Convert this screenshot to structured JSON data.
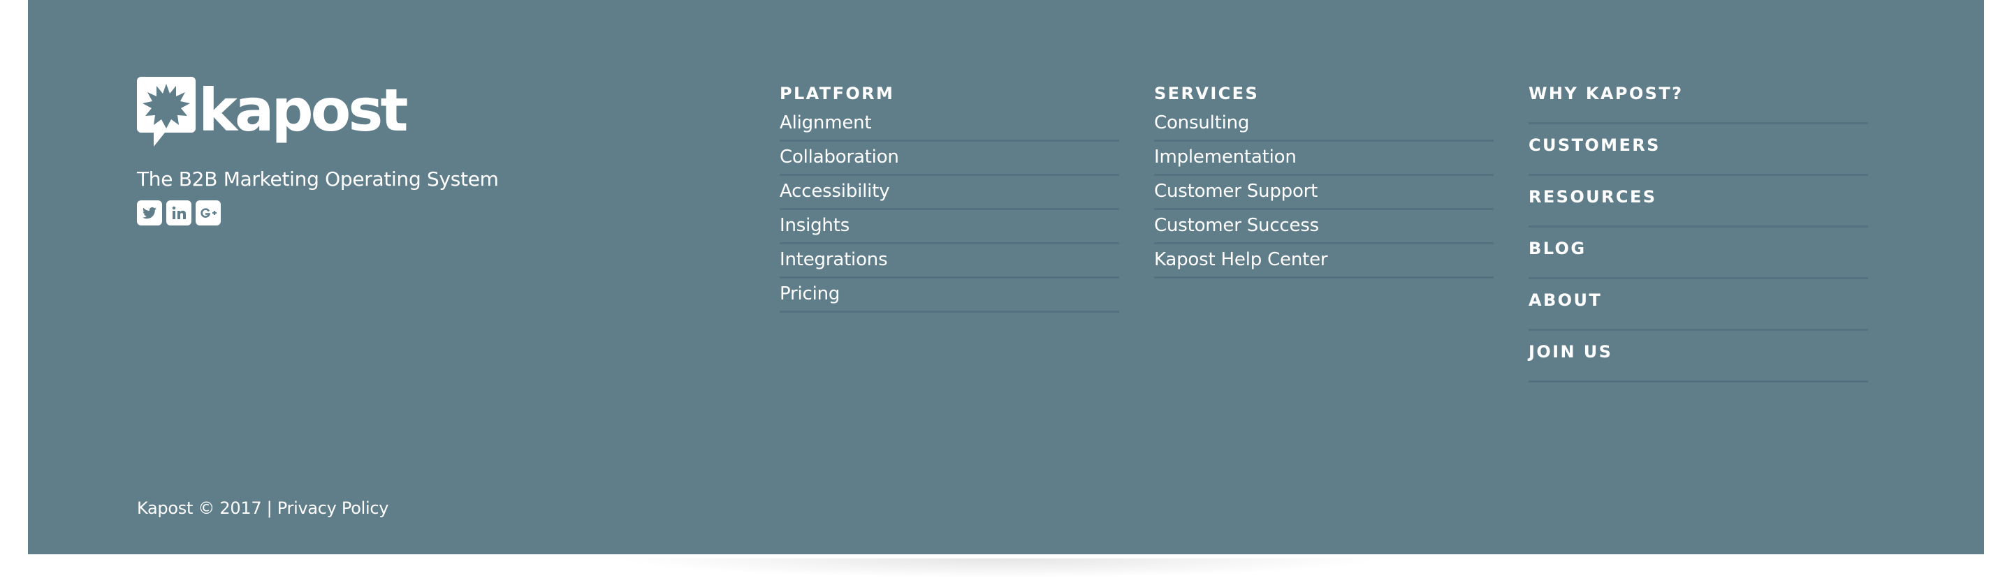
{
  "brand": {
    "logo_text": "kapost",
    "tagline": "The B2B Marketing Operating System",
    "social_icons": [
      "twitter-icon",
      "linkedin-icon",
      "google-plus-icon"
    ]
  },
  "platform": {
    "heading": "PLATFORM",
    "links": [
      "Alignment",
      "Collaboration",
      "Accessibility",
      "Insights",
      "Integrations",
      "Pricing"
    ]
  },
  "services": {
    "heading": "SERVICES",
    "links": [
      "Consulting",
      "Implementation",
      "Customer Support",
      "Customer Success",
      "Kapost Help Center"
    ]
  },
  "main_links": [
    "WHY KAPOST?",
    "CUSTOMERS",
    "RESOURCES",
    "BLOG",
    "ABOUT",
    "JOIN US"
  ],
  "footer": {
    "copyright": "Kapost © 2017 |",
    "privacy_label": "Privacy Policy"
  },
  "colors": {
    "footer_bg": "#607d8a",
    "divider": "#557080",
    "text": "#ffffff"
  }
}
